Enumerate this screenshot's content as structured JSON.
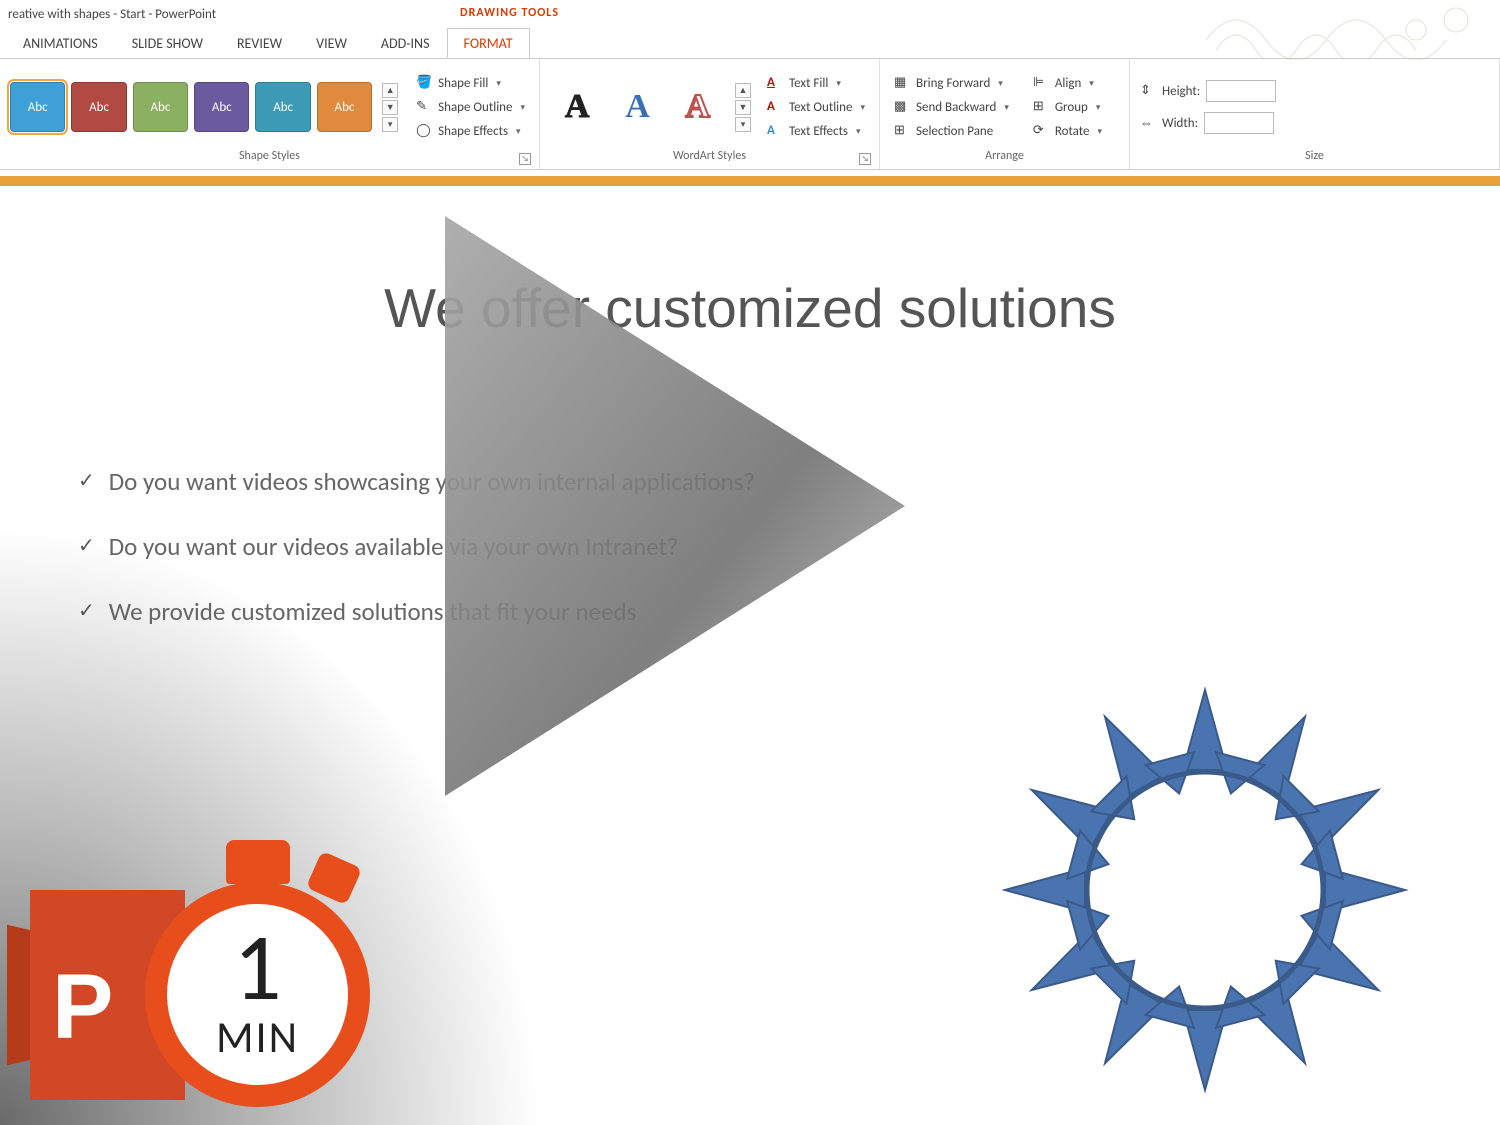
{
  "app": {
    "title_fragment": "reative with shapes - Start - PowerPoint",
    "context_tab_group": "DRAWING TOOLS"
  },
  "tabs": {
    "animations": "ANIMATIONS",
    "slideshow": "SLIDE SHOW",
    "review": "REVIEW",
    "view": "VIEW",
    "addins": "ADD-INS",
    "format": "FORMAT"
  },
  "ribbon": {
    "shape_styles_label": "Shape Styles",
    "wordart_styles_label": "WordArt Styles",
    "arrange_label": "Arrange",
    "size_label": "Size",
    "style_sample": "Abc",
    "shape_fill": "Shape Fill",
    "shape_outline": "Shape Outline",
    "shape_effects": "Shape Effects",
    "text_fill": "Text Fill",
    "text_outline": "Text Outline",
    "text_effects": "Text Effects",
    "bring_forward": "Bring Forward",
    "send_backward": "Send Backward",
    "selection_pane": "Selection Pane",
    "align": "Align",
    "group": "Group",
    "rotate": "Rotate",
    "height": "Height:",
    "width": "Width:",
    "style_colors": [
      "#3fa0d8",
      "#b04a42",
      "#8cb061",
      "#6b5aa0",
      "#3d9bb8",
      "#e08a3e"
    ]
  },
  "slide": {
    "title": "We offer customized solutions",
    "bullets": [
      "Do you want videos showcasing your own internal applications?",
      "Do you want our videos available via your own Intranet?",
      "We provide customized solutions that fit your needs"
    ],
    "badge_letter": "P",
    "timer_number": "1",
    "timer_unit": "MIN"
  }
}
